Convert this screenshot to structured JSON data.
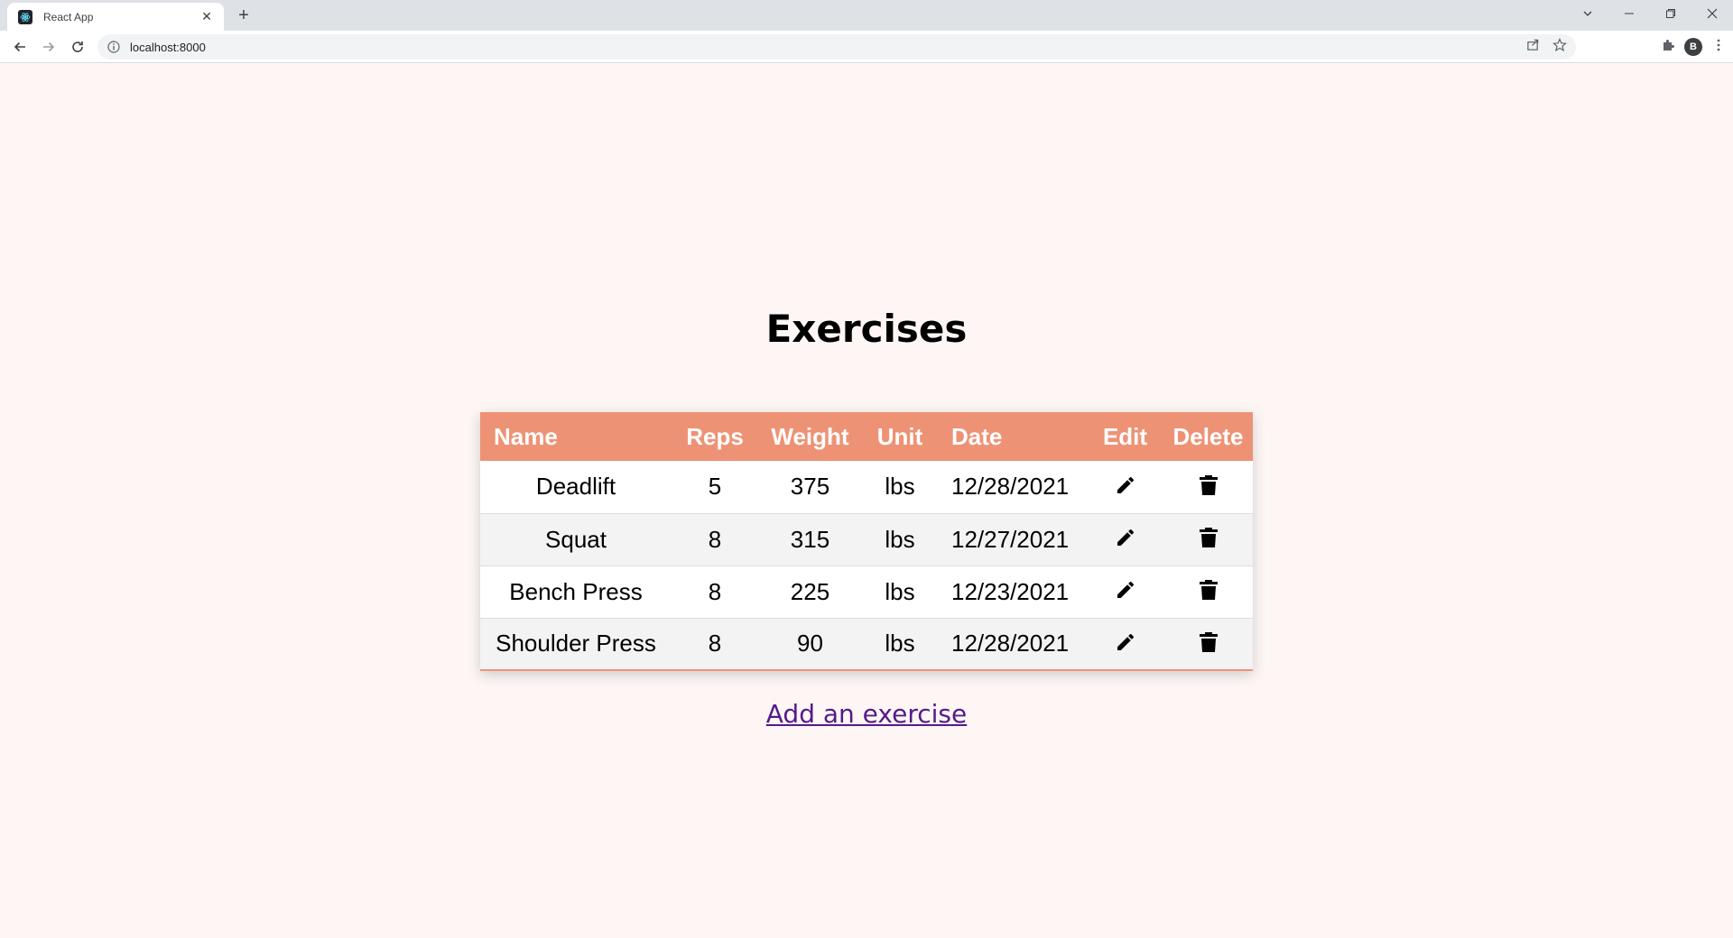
{
  "browser": {
    "tab_title": "React App",
    "url": "localhost:8000",
    "profile_initial": "B"
  },
  "page": {
    "title": "Exercises",
    "add_link_label": "Add an exercise"
  },
  "table": {
    "headers": {
      "name": "Name",
      "reps": "Reps",
      "weight": "Weight",
      "unit": "Unit",
      "date": "Date",
      "edit": "Edit",
      "delete": "Delete"
    },
    "rows": [
      {
        "name": "Deadlift",
        "reps": "5",
        "weight": "375",
        "unit": "lbs",
        "date": "12/28/2021"
      },
      {
        "name": "Squat",
        "reps": "8",
        "weight": "315",
        "unit": "lbs",
        "date": "12/27/2021"
      },
      {
        "name": "Bench Press",
        "reps": "8",
        "weight": "225",
        "unit": "lbs",
        "date": "12/23/2021"
      },
      {
        "name": "Shoulder Press",
        "reps": "8",
        "weight": "90",
        "unit": "lbs",
        "date": "12/28/2021"
      }
    ]
  },
  "icons": {
    "edit": "pencil-icon",
    "delete": "trash-icon"
  },
  "colors": {
    "header_bg": "#ee9275",
    "page_bg": "#fdf6f5",
    "link": "#551a8b"
  }
}
